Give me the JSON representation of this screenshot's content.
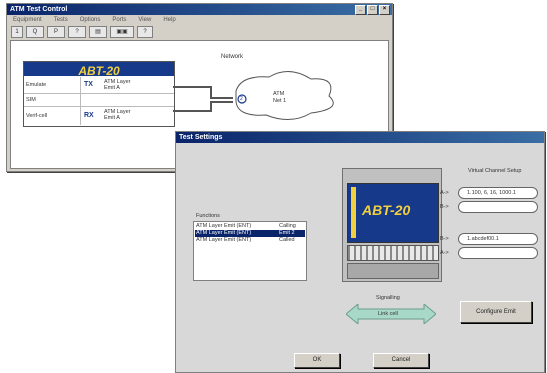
{
  "main_window": {
    "title": "ATM Test Control",
    "menu": [
      "Equipment",
      "Tests",
      "Options",
      "Ports",
      "View",
      "Help"
    ],
    "toolbar": [
      "1",
      "Q",
      "P",
      "?",
      "▤",
      "▣▣",
      "?"
    ],
    "device": {
      "name": "ABT-20",
      "rows": [
        {
          "label": "Emulate",
          "icon": "TX",
          "value": "ATM Layer Emit A"
        },
        {
          "label": "SIM",
          "icon": "",
          "value": ""
        },
        {
          "label": "Verif-cell",
          "icon": "RX",
          "value": "ATM Layer Emit A"
        }
      ]
    },
    "connection_label": "Network",
    "cloud": {
      "badge": "2",
      "line1": "ATM",
      "line2": "Net 1"
    }
  },
  "dialog": {
    "title": "Test Settings",
    "list_label": "Functions",
    "list_items": [
      {
        "text": "ATM Layer Emit (ENT)",
        "status": "Calling"
      },
      {
        "text": "ATM Layer Emit (ENT)",
        "status": "Emit 2"
      },
      {
        "text": "ATM Layer Emit (ENT)",
        "status": "Called"
      }
    ],
    "device_label": "ABT-20",
    "connection_caption": "Signalling",
    "arrow_label": "Link cell",
    "vs_title": "Virtual Channel Setup",
    "vs_rows": [
      {
        "prefix": "A->",
        "value": "1.100, 6, 16, 1000.1"
      },
      {
        "prefix": "B->",
        "value": ""
      },
      {
        "prefix": "B->",
        "value": "1.abcdef00.1"
      },
      {
        "prefix": "A->",
        "value": ""
      }
    ],
    "configure_button": "Configure Emit",
    "ok_button": "OK",
    "cancel_button": "Cancel"
  },
  "colors": {
    "title_blue": "#0a246a",
    "device_blue": "#17398a",
    "device_yellow": "#f0d040",
    "arrow_teal": "#a8d8c8"
  }
}
